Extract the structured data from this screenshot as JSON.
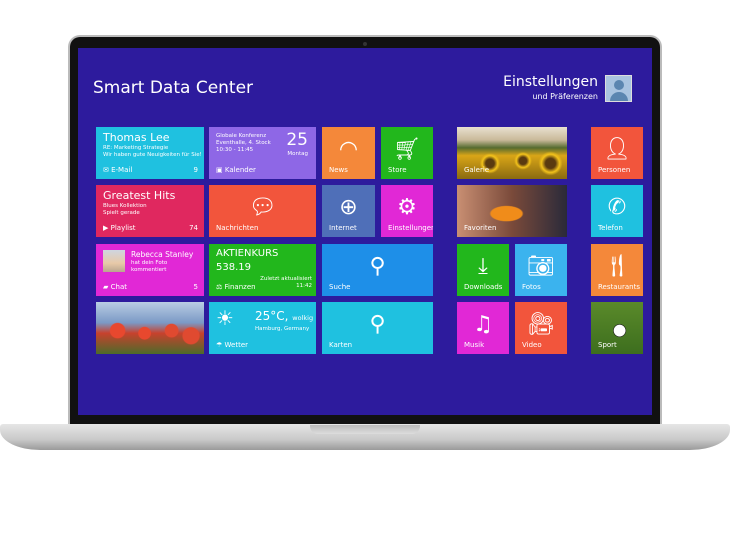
{
  "app": {
    "title": "Smart Data Center"
  },
  "user": {
    "name": "Einstellungen",
    "subtitle": "und Präferenzen"
  },
  "tiles": {
    "mail": {
      "name": "Thomas Lee",
      "line1": "RE: Marketing Strategie",
      "line2": "Wir haben gute Neuigkeiten für Sie!",
      "label": "E-Mail",
      "count": "9",
      "color": "#1fc1e0"
    },
    "calendar": {
      "line1": "Globale Konferenz",
      "line2": "Eventhalle, 4. Stock",
      "line3": "10:30 - 11:45",
      "day": "25",
      "weekday": "Montag",
      "label": "Kalender",
      "color": "#8e67e6"
    },
    "news": {
      "label": "News",
      "color": "#f4883a"
    },
    "store": {
      "label": "Store",
      "color": "#22b71c"
    },
    "music_playlist": {
      "title": "Greatest Hits",
      "line1": "Blues Kollektion",
      "line2": "Spielt gerade",
      "label": "Playlist",
      "count": "74",
      "color": "#e0285f"
    },
    "messages": {
      "label": "Nachrichten",
      "color": "#f2553c"
    },
    "internet": {
      "label": "Internet",
      "color": "#4f6fb8"
    },
    "settings": {
      "label": "Einstellungen",
      "color": "#e128d6"
    },
    "chat": {
      "name": "Rebecca Stanley",
      "line1": "hat dein Foto",
      "line2": "kommentiert",
      "label": "Chat",
      "count": "5",
      "color": "#e128d6"
    },
    "stock": {
      "title": "AKTIENKURS",
      "value": "538.19",
      "updated": "Zuletzt aktualisiert",
      "time": "11:42",
      "label": "Finanzen",
      "color": "#22b71c"
    },
    "search": {
      "label": "Suche",
      "color": "#1e8fe8"
    },
    "weather": {
      "temp": "25°C,",
      "condition": "wolkig",
      "location": "Hamburg, Germany",
      "label": "Wetter",
      "color": "#1fc1e0"
    },
    "maps": {
      "label": "Karten",
      "color": "#1fc1e0"
    },
    "gallery": {
      "label": "Galerie"
    },
    "favorites": {
      "label": "Favoriten"
    },
    "downloads": {
      "label": "Downloads",
      "color": "#22b71c"
    },
    "photos": {
      "label": "Fotos",
      "color": "#3bb3ee"
    },
    "music": {
      "label": "Musik",
      "color": "#e128d6"
    },
    "video": {
      "label": "Video",
      "color": "#f2553c"
    },
    "people": {
      "label": "Personen",
      "color": "#f2553c"
    },
    "phone": {
      "label": "Telefon",
      "color": "#1fc1e0"
    },
    "restaurants": {
      "label": "Restaurants",
      "color": "#f4883a"
    },
    "sport": {
      "label": "Sport"
    }
  }
}
